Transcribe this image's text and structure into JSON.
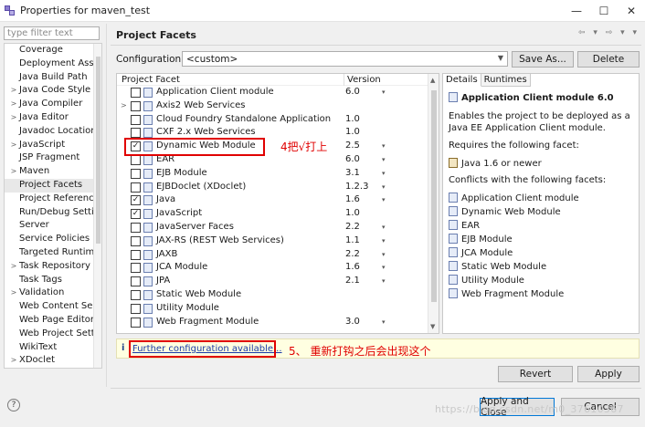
{
  "window": {
    "title": "Properties for maven_test",
    "controls": [
      "—",
      "☐",
      "✕"
    ]
  },
  "filter": {
    "placeholder": "type filter text"
  },
  "tree": [
    {
      "label": "Coverage",
      "twisty": ""
    },
    {
      "label": "Deployment Asse",
      "twisty": ""
    },
    {
      "label": "Java Build Path",
      "twisty": ""
    },
    {
      "label": "Java Code Style",
      "twisty": ">"
    },
    {
      "label": "Java Compiler",
      "twisty": ">"
    },
    {
      "label": "Java Editor",
      "twisty": ">"
    },
    {
      "label": "Javadoc Location",
      "twisty": ""
    },
    {
      "label": "JavaScript",
      "twisty": ">"
    },
    {
      "label": "JSP Fragment",
      "twisty": ""
    },
    {
      "label": "Maven",
      "twisty": ">"
    },
    {
      "label": "Project Facets",
      "twisty": "",
      "selected": true
    },
    {
      "label": "Project Referenc",
      "twisty": ""
    },
    {
      "label": "Run/Debug Setti",
      "twisty": ""
    },
    {
      "label": "Server",
      "twisty": ""
    },
    {
      "label": "Service Policies",
      "twisty": ""
    },
    {
      "label": "Targeted Runtim",
      "twisty": ""
    },
    {
      "label": "Task Repository",
      "twisty": ">"
    },
    {
      "label": "Task Tags",
      "twisty": ""
    },
    {
      "label": "Validation",
      "twisty": ">"
    },
    {
      "label": "Web Content Se",
      "twisty": ""
    },
    {
      "label": "Web Page Editor",
      "twisty": ""
    },
    {
      "label": "Web Project Setti",
      "twisty": ""
    },
    {
      "label": "WikiText",
      "twisty": ""
    },
    {
      "label": "XDoclet",
      "twisty": ">"
    }
  ],
  "page": {
    "title": "Project Facets",
    "nav": "⇦ ▾ ⇨ ▾ ▾"
  },
  "config": {
    "label": "Configuration:",
    "value": "<custom>",
    "save_as": "Save As...",
    "delete": "Delete"
  },
  "facets_table": {
    "headers": {
      "facet": "Project Facet",
      "version": "Version"
    },
    "rows": [
      {
        "name": "Application Client module",
        "version": "6.0",
        "dd": "▾",
        "checked": "",
        "twisty": ""
      },
      {
        "name": "Axis2 Web Services",
        "version": "",
        "dd": "",
        "checked": "",
        "twisty": ">"
      },
      {
        "name": "Cloud Foundry Standalone Application",
        "version": "1.0",
        "dd": "",
        "checked": "",
        "twisty": ""
      },
      {
        "name": "CXF 2.x Web Services",
        "version": "1.0",
        "dd": "",
        "checked": "",
        "twisty": ""
      },
      {
        "name": "Dynamic Web Module",
        "version": "2.5",
        "dd": "▾",
        "checked": "✓",
        "twisty": ""
      },
      {
        "name": "EAR",
        "version": "6.0",
        "dd": "▾",
        "checked": "",
        "twisty": ""
      },
      {
        "name": "EJB Module",
        "version": "3.1",
        "dd": "▾",
        "checked": "",
        "twisty": ""
      },
      {
        "name": "EJBDoclet (XDoclet)",
        "version": "1.2.3",
        "dd": "▾",
        "checked": "",
        "twisty": ""
      },
      {
        "name": "Java",
        "version": "1.6",
        "dd": "▾",
        "checked": "✓",
        "twisty": ""
      },
      {
        "name": "JavaScript",
        "version": "1.0",
        "dd": "",
        "checked": "✓",
        "twisty": ""
      },
      {
        "name": "JavaServer Faces",
        "version": "2.2",
        "dd": "▾",
        "checked": "",
        "twisty": ""
      },
      {
        "name": "JAX-RS (REST Web Services)",
        "version": "1.1",
        "dd": "▾",
        "checked": "",
        "twisty": ""
      },
      {
        "name": "JAXB",
        "version": "2.2",
        "dd": "▾",
        "checked": "",
        "twisty": ""
      },
      {
        "name": "JCA Module",
        "version": "1.6",
        "dd": "▾",
        "checked": "",
        "twisty": ""
      },
      {
        "name": "JPA",
        "version": "2.1",
        "dd": "▾",
        "checked": "",
        "twisty": ""
      },
      {
        "name": "Static Web Module",
        "version": "",
        "dd": "",
        "checked": "",
        "twisty": ""
      },
      {
        "name": "Utility Module",
        "version": "",
        "dd": "",
        "checked": "",
        "twisty": ""
      },
      {
        "name": "Web Fragment Module",
        "version": "3.0",
        "dd": "▾",
        "checked": "",
        "twisty": ""
      }
    ]
  },
  "details": {
    "tabs": [
      "Details",
      "Runtimes"
    ],
    "title": "Application Client module 6.0",
    "desc1": "Enables the project to be deployed as a",
    "desc2": "Java EE Application Client module.",
    "requires_label": "Requires the following facet:",
    "requires": [
      "Java 1.6 or newer"
    ],
    "conflicts_label": "Conflicts with the following facets:",
    "conflicts": [
      "Application Client module",
      "Dynamic Web Module",
      "EAR",
      "EJB Module",
      "JCA Module",
      "Static Web Module",
      "Utility Module",
      "Web Fragment Module"
    ]
  },
  "info": {
    "icon": "i",
    "link": "Further configuration available..."
  },
  "annotations": {
    "a4": "4把√打上",
    "a5": "5、 重新打钩之后会出现这个"
  },
  "buttons": {
    "revert": "Revert",
    "apply": "Apply",
    "apply_close": "Apply and Close",
    "cancel": "Cancel",
    "help": "?"
  },
  "watermark": "https://blog.csdn.net/m0_37610367",
  "colors": {
    "annotation": "#e00000",
    "link": "#1a3aa8",
    "info_bg": "#ffffe1"
  }
}
